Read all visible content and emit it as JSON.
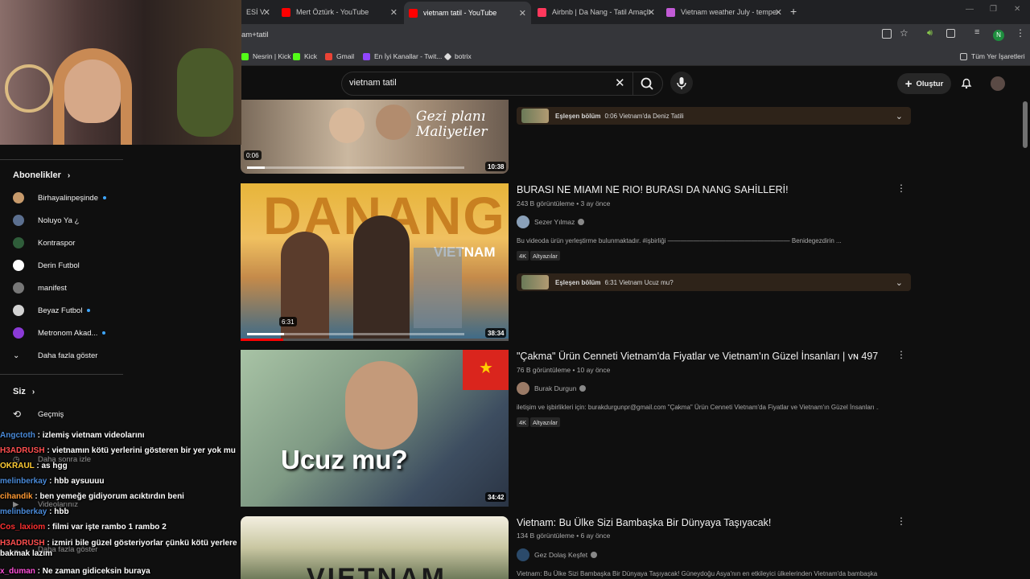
{
  "browser": {
    "tabs": [
      {
        "label": "ESİ V",
        "color": "#ff0000"
      },
      {
        "label": "Mert Öztürk - YouTube",
        "color": "#ff0000"
      },
      {
        "label": "vietnam tatil - YouTube",
        "color": "#ff0000"
      },
      {
        "label": "Airbnb | Da Nang - Tatil Amaçlı",
        "color": "#ff385c"
      },
      {
        "label": "Vietnam weather July - temperat",
        "color": "#c25bd6"
      }
    ],
    "address": "am+tatil",
    "bookmarks": [
      "Nesrin | Kick",
      "Kick",
      "Gmail",
      "En İyi Kanallar - Twit...",
      "botrix"
    ],
    "all_bookmarks": "Tüm Yer İşaretleri",
    "profile_letter": "N"
  },
  "sidebar": {
    "subs_header": "Abonelikler",
    "subs": [
      {
        "name": "Birhayalinpeşinde",
        "dot": true,
        "color": "#c79a6b"
      },
      {
        "name": "Noluyo Ya ¿",
        "dot": false,
        "color": "#5b6f8f"
      },
      {
        "name": "Kontraspor",
        "dot": false,
        "color": "#2f5d3a"
      },
      {
        "name": "Derin Futbol",
        "dot": false,
        "color": "#ffffff"
      },
      {
        "name": "manifest",
        "dot": false,
        "color": "#777777"
      },
      {
        "name": "Beyaz Futbol",
        "dot": true,
        "color": "#d2d2d2"
      },
      {
        "name": "Metronom Akad...",
        "dot": true,
        "color": "#8b3ad6"
      }
    ],
    "more": "Daha fazla göster",
    "you_header": "Siz",
    "history": "Geçmiş",
    "watch_later": "Daha sonra izle",
    "your_videos": "Videolarınız",
    "show_more2": "Daha fazla göster"
  },
  "header": {
    "search_value": "vietnam tatil",
    "create": "Oluştur"
  },
  "videos": [
    {
      "overlay_text": "Gezi planı\nMaliyetler",
      "duration": "10:38",
      "progress_time": "0:06",
      "match_label": "Eşleşen bölüm",
      "match_text": "0:06 Vietnam'da Deniz Tatili"
    },
    {
      "title": "BURASI NE MIAMI NE RIO! BURASI DA NANG SAHİLLERİ!",
      "meta": "243 B görüntüleme • 3 ay önce",
      "channel": "Sezer Yılmaz",
      "desc": "Bu videoda ürün yerleştirme bulunmaktadır. #işbirliği ——————————————————— Benidegezdirin ...",
      "badges": [
        "4K",
        "Altyazılar"
      ],
      "duration": "38:34",
      "progress_time": "6:31",
      "overlay_big": "DANANG",
      "overlay_small": "VIETNAM",
      "match_label": "Eşleşen bölüm",
      "match_text": "6:31 Vietnam Ucuz mu?"
    },
    {
      "title": "\"Çakma\" Ürün Cenneti Vietnam'da Fiyatlar ve Vietnam'ın Güzel İnsanları | ᴠɴ 497",
      "meta": "76 B görüntüleme • 10 ay önce",
      "channel": "Burak Durgun",
      "desc": "iletişim ve işbirlikleri için: burakdurgunpr@gmail.com \"Çakma\" Ürün Cenneti Vietnam'da Fiyatlar ve Vietnam'ın Güzel İnsanları ...",
      "badges": [
        "4K",
        "Altyazılar"
      ],
      "duration": "34:42",
      "overlay_text": "Ucuz mu?"
    },
    {
      "title": "Vietnam: Bu Ülke Sizi Bambaşka Bir Dünyaya Taşıyacak!",
      "meta": "134 B görüntüleme • 6 ay önce",
      "channel": "Gez Dolaş Keşfet",
      "desc": "Vietnam: Bu Ülke Sizi Bambaşka Bir Dünyaya Taşıyacak! Güneydoğu Asya'nın en etkileyici ülkelerinden Vietnam'da bambaşka ...",
      "overlay_text": "VIETNAM"
    }
  ],
  "chat": [
    {
      "user": "Angctoth",
      "text": "izlemiş vietnam videolarını",
      "color": "#4a8ad8"
    },
    {
      "user": "H3ADRUSH",
      "text": "vietnamın kötü yerlerini gösteren bir yer yok mu",
      "color": "#ff4f4f"
    },
    {
      "user": "OKRAUL",
      "text": "as hgg",
      "color": "#ffcc33"
    },
    {
      "user": "melinberkay",
      "text": "hbb aysuuuu",
      "color": "#4a8ad8"
    },
    {
      "user": "cihandik",
      "text": "ben yemeğe gidiyorum acıktırdın beni",
      "color": "#ff9933"
    },
    {
      "user": "melinberkay",
      "text": "hbb",
      "color": "#4a8ad8"
    },
    {
      "user": "Cos_laxiom",
      "text": "filmi var işte rambo 1 rambo 2",
      "color": "#ff3030"
    },
    {
      "user": "H3ADRUSH",
      "text": "izmiri bile güzel gösteriyorlar çünkü kötü yerlere bakmak lazım",
      "color": "#ff4f4f"
    },
    {
      "user": "x_duman",
      "text": "Ne zaman gidiceksin buraya",
      "color": "#ff4fd8"
    }
  ]
}
